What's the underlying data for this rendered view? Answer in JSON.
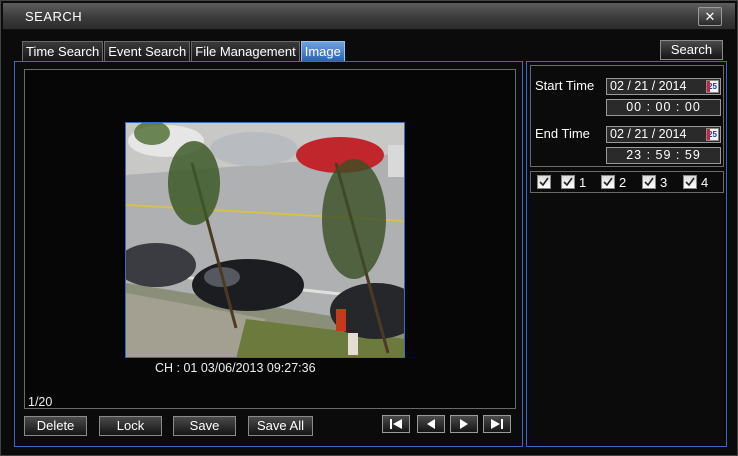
{
  "window": {
    "title": "SEARCH",
    "close_label": "✕"
  },
  "tabs": [
    {
      "label": "Time Search",
      "active": false
    },
    {
      "label": "Event Search",
      "active": false
    },
    {
      "label": "File Management",
      "active": false
    },
    {
      "label": "Image",
      "active": true
    }
  ],
  "search_button": "Search",
  "preview": {
    "caption": "CH : 01   03/06/2013 09:27:36",
    "counter": "1/20"
  },
  "actions": {
    "delete": "Delete",
    "lock": "Lock",
    "save": "Save",
    "save_all": "Save All"
  },
  "navigation": [
    "first-page-icon",
    "previous-icon",
    "next-icon",
    "last-page-icon"
  ],
  "time_filter": {
    "start_label": "Start Time",
    "start_date": "02 / 21 / 2014",
    "start_time": "00  :  00  :  00",
    "end_label": "End Time",
    "end_date": "02 / 21 / 2014",
    "end_time": "23  :  59  :  59",
    "calendar_glyph": "25"
  },
  "channels": {
    "all_checked": true,
    "items": [
      {
        "label": "1",
        "checked": true
      },
      {
        "label": "2",
        "checked": true
      },
      {
        "label": "3",
        "checked": true
      },
      {
        "label": "4",
        "checked": true
      }
    ]
  },
  "colors": {
    "accent_border": "#3e68c6",
    "active_tab": "#3f74c6"
  }
}
